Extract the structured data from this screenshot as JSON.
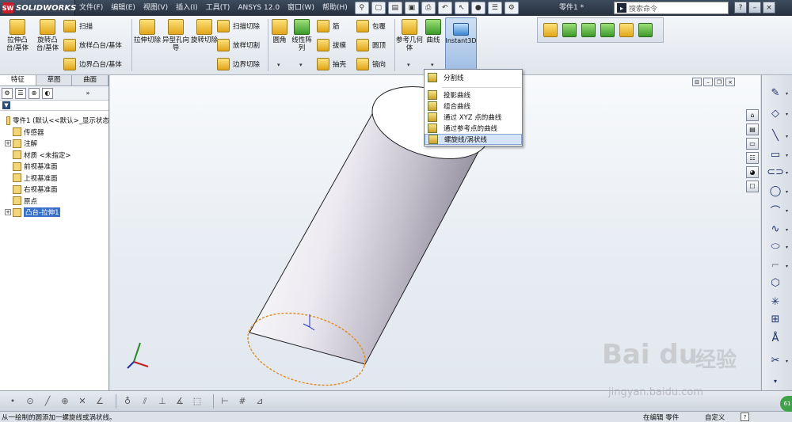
{
  "app": {
    "brand": "SOLIDWORKS",
    "logo_text": "SW",
    "document_title": "零件1 *"
  },
  "menu": [
    "文件(F)",
    "编辑(E)",
    "视图(V)",
    "插入(I)",
    "工具(T)",
    "ANSYS 12.0",
    "窗口(W)",
    "帮助(H)"
  ],
  "search": {
    "placeholder": "搜索命令"
  },
  "ribbon": {
    "extrude_boss": "拉伸凸台/基体",
    "revolve_boss": "旋转凸台/基体",
    "sweep": "扫描",
    "loft": "放样凸台/基体",
    "boundary_boss": "边界凸台/基体",
    "extrude_cut": "拉伸切除",
    "hole_wizard": "异型孔向导",
    "revolve_cut": "旋转切除",
    "sweep_cut": "扫描切除",
    "loft_cut": "放样切割",
    "boundary_cut": "边界切除",
    "fillet": "圆角",
    "linear_pattern": "线性阵列",
    "rib": "筋",
    "draft": "拔模",
    "shell": "抽壳",
    "wrap": "包覆",
    "dome": "圆顶",
    "mirror": "镜向",
    "ref_geometry": "参考几何体",
    "curves": "曲线",
    "instant3d": "Instant3D"
  },
  "dropdown": {
    "items": [
      "分割线",
      "投影曲线",
      "组合曲线",
      "通过 XYZ 点的曲线",
      "通过参考点的曲线",
      "螺旋线/涡状线"
    ],
    "highlighted_index": 5
  },
  "panel": {
    "tabs": [
      "特征",
      "草图",
      "曲面"
    ],
    "active_tab": 0,
    "tree": [
      {
        "label": "零件1 (默认<<默认>_显示状态",
        "indent": 0,
        "expand": ""
      },
      {
        "label": "传感器",
        "indent": 1,
        "expand": ""
      },
      {
        "label": "注解",
        "indent": 1,
        "expand": "+"
      },
      {
        "label": "材质 <未指定>",
        "indent": 1,
        "expand": ""
      },
      {
        "label": "前视基准面",
        "indent": 1,
        "expand": ""
      },
      {
        "label": "上视基准面",
        "indent": 1,
        "expand": ""
      },
      {
        "label": "右视基准面",
        "indent": 1,
        "expand": ""
      },
      {
        "label": "原点",
        "indent": 1,
        "expand": ""
      },
      {
        "label": "凸台-拉伸1",
        "indent": 1,
        "expand": "+",
        "selected": true
      }
    ]
  },
  "status": {
    "message": "从一绘制的圆添加一螺旋线或涡状线。",
    "mode": "在编辑 零件",
    "units": "自定义"
  },
  "watermark": {
    "brand": "Bai du",
    "cn": "经验",
    "url": "jingyan.baidu.com"
  },
  "badge": "61"
}
